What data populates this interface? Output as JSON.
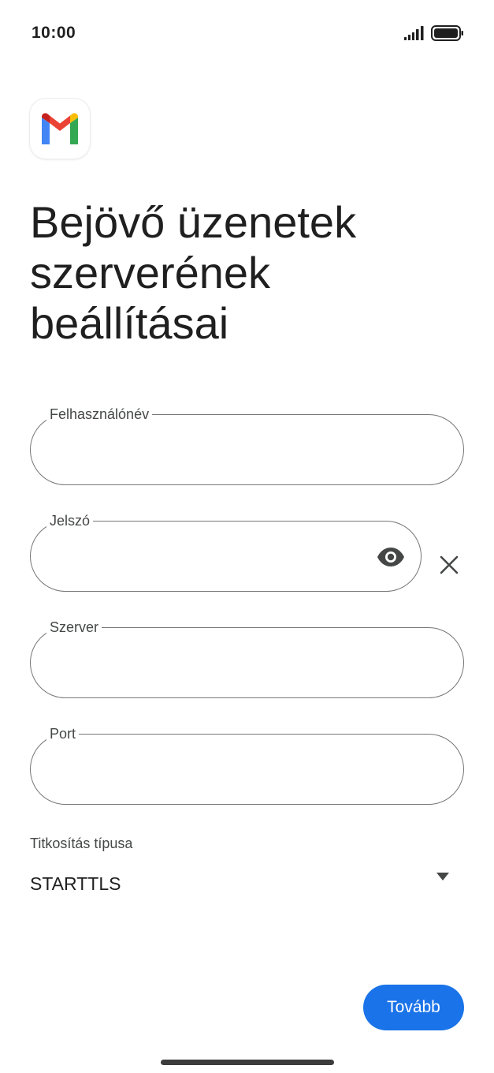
{
  "status_bar": {
    "time": "10:00",
    "signal_icon": "signal-bars-icon",
    "battery_icon": "battery-full-icon"
  },
  "app": {
    "logo_icon": "gmail-logo-icon"
  },
  "page": {
    "title": "Bejövő üzenetek szerverének beállításai"
  },
  "form": {
    "username": {
      "label": "Felhasználónév",
      "value": ""
    },
    "password": {
      "label": "Jelszó",
      "value": "",
      "toggle_icon": "eye-icon",
      "clear_icon": "close-icon"
    },
    "server": {
      "label": "Szerver",
      "value": ""
    },
    "port": {
      "label": "Port",
      "value": ""
    },
    "encryption": {
      "label": "Titkosítás típusa",
      "selected": "STARTTLS",
      "dropdown_icon": "arrow-drop-down-icon"
    }
  },
  "actions": {
    "next_label": "Tovább"
  },
  "colors": {
    "primary": "#1a73e8",
    "outline": "#747775",
    "text": "#1f1f1f",
    "label": "#444746"
  }
}
